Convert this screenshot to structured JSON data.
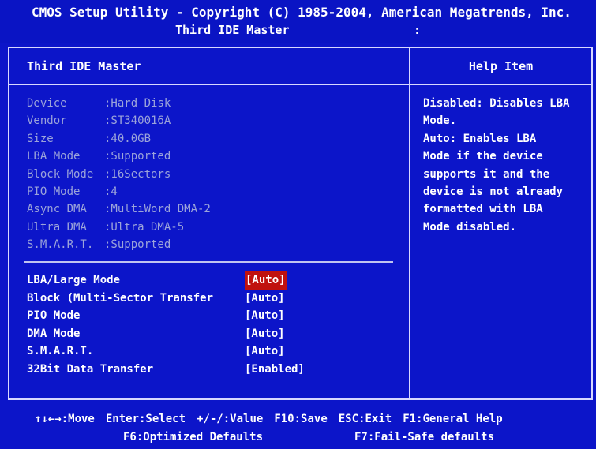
{
  "header": {
    "app_title": "CMOS Setup Utility - Copyright (C) 1985-2004, American Megatrends, Inc.",
    "screen_title": "Third IDE Master",
    "colon": ":"
  },
  "left_panel": {
    "title": "Third IDE Master",
    "device_info": [
      {
        "label": "Device",
        "value": ":Hard Disk"
      },
      {
        "label": "Vendor",
        "value": ":ST340016A"
      },
      {
        "label": "Size",
        "value": ":40.0GB"
      },
      {
        "label": "LBA Mode",
        "value": ":Supported"
      },
      {
        "label": "Block Mode",
        "value": ":16Sectors"
      },
      {
        "label": "PIO Mode",
        "value": ":4"
      },
      {
        "label": "Async DMA",
        "value": ":MultiWord DMA-2"
      },
      {
        "label": "Ultra DMA",
        "value": ":Ultra DMA-5"
      },
      {
        "label": "S.M.A.R.T.",
        "value": ":Supported"
      }
    ],
    "settings": [
      {
        "label": "LBA/Large Mode",
        "value": "[Auto]",
        "selected": true
      },
      {
        "label": "Block (Multi-Sector Transfer",
        "value": "[Auto]"
      },
      {
        "label": "PIO Mode",
        "value": "[Auto]"
      },
      {
        "label": "DMA Mode",
        "value": "[Auto]"
      },
      {
        "label": "S.M.A.R.T.",
        "value": "[Auto]"
      },
      {
        "label": "32Bit Data Transfer",
        "value": "[Enabled]"
      }
    ]
  },
  "help": {
    "title": "Help Item",
    "lines": [
      "Disabled: Disables LBA",
      "Mode.",
      "Auto: Enables LBA",
      "Mode if the device",
      "supports it and the",
      "device is not already",
      "formatted with LBA",
      "Mode disabled."
    ]
  },
  "footer": {
    "row1": {
      "move": "↑↓←→:Move",
      "select": "Enter:Select",
      "value": "+/-/:Value",
      "save": "F10:Save",
      "exit": "ESC:Exit",
      "general_help": "F1:General Help"
    },
    "row2": {
      "optimized": "F6:Optimized Defaults",
      "failsafe": "F7:Fail-Safe defaults"
    }
  },
  "colors": {
    "background": "#0c15c9",
    "selected_value_bg": "#c0110f",
    "dim_text": "#9ca4da",
    "text": "#ffffff"
  }
}
